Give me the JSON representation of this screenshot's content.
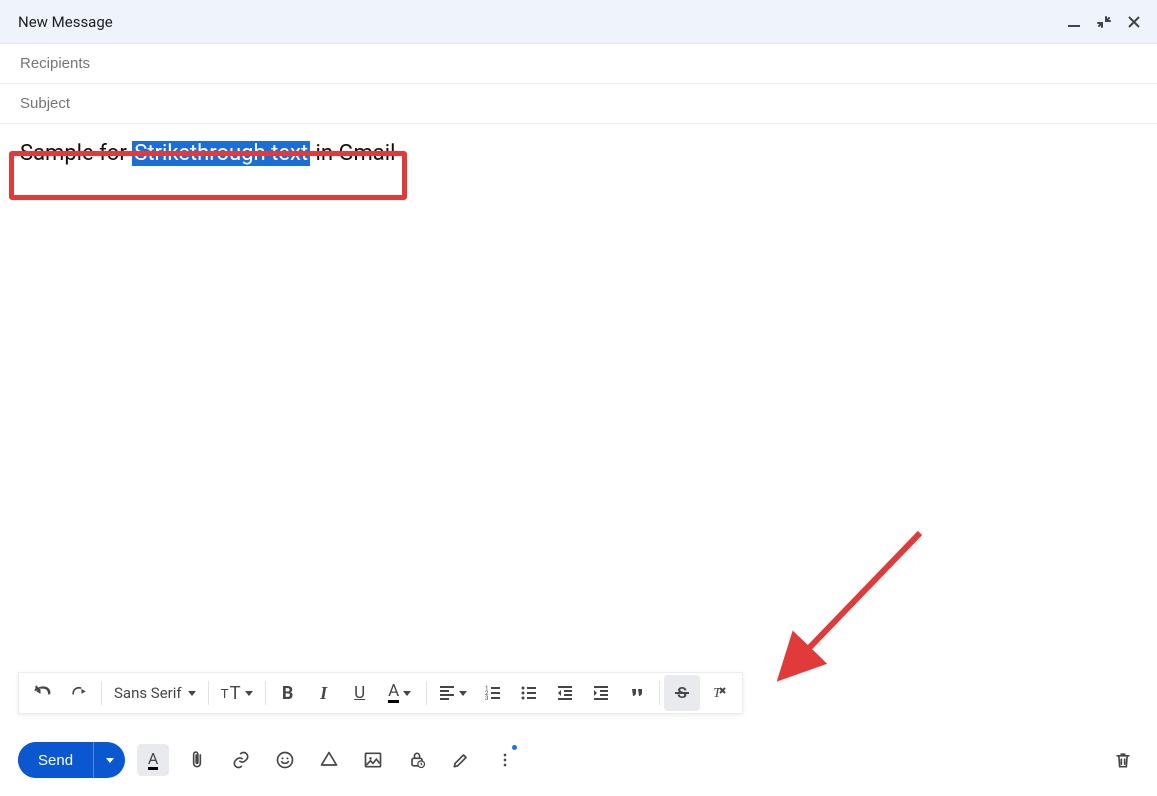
{
  "header": {
    "title": "New Message"
  },
  "fields": {
    "recipients_placeholder": "Recipients",
    "subject_placeholder": "Subject"
  },
  "body": {
    "before": "Sample for ",
    "selected_strike": "Strikethrough text",
    "after": " in Gmail"
  },
  "format_toolbar": {
    "font_family": "Sans Serif"
  },
  "actions": {
    "send_label": "Send"
  }
}
